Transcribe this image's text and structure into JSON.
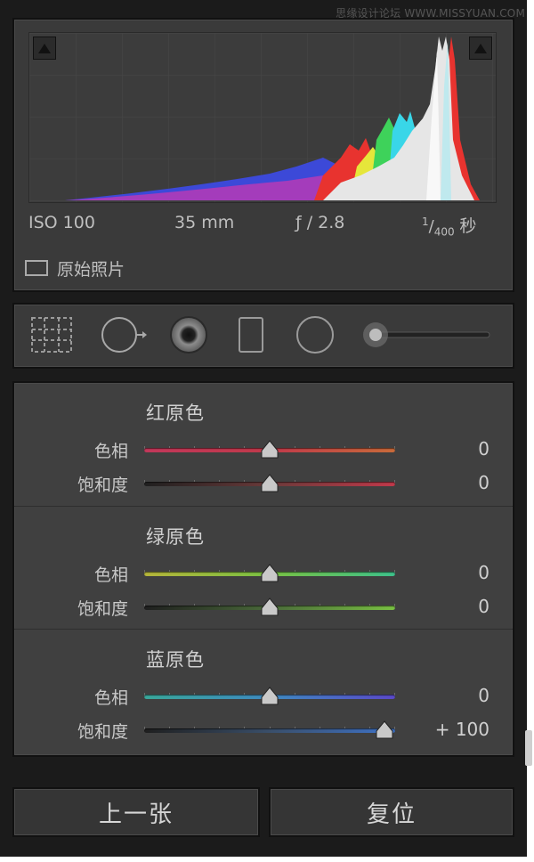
{
  "watermark": "思缘设计论坛 WWW.MISSYUAN.COM",
  "histogram": {
    "iso": "ISO 100",
    "focal_length": "35 mm",
    "aperture": "ƒ / 2.8",
    "shutter_num": "1",
    "shutter_den": "400",
    "shutter_unit": "秒",
    "original_photo_label": "原始照片"
  },
  "tools": [
    {
      "name": "crop-overlay-tool",
      "icon": "crop-grid-icon"
    },
    {
      "name": "spot-removal-tool",
      "icon": "spot-heal-icon"
    },
    {
      "name": "red-eye-tool",
      "icon": "red-eye-icon"
    },
    {
      "name": "graduated-filter-tool",
      "icon": "rect-filter-icon"
    },
    {
      "name": "radial-filter-tool",
      "icon": "circle-filter-icon"
    },
    {
      "name": "adjustment-brush-tool",
      "icon": "brush-slider-icon"
    }
  ],
  "calibration": {
    "red": {
      "title": "红原色",
      "hue_label": "色相",
      "hue_value": "0",
      "hue_pos": 0.5,
      "sat_label": "饱和度",
      "sat_value": "0",
      "sat_pos": 0.5
    },
    "green": {
      "title": "绿原色",
      "hue_label": "色相",
      "hue_value": "0",
      "hue_pos": 0.5,
      "sat_label": "饱和度",
      "sat_value": "0",
      "sat_pos": 0.5
    },
    "blue": {
      "title": "蓝原色",
      "hue_label": "色相",
      "hue_value": "0",
      "hue_pos": 0.5,
      "sat_label": "饱和度",
      "sat_value": "+ 100",
      "sat_pos": 1.0
    }
  },
  "buttons": {
    "previous": "上一张",
    "reset": "复位"
  },
  "colors": {
    "panel_bg": "#3a3a3a",
    "text": "#c8c8c8",
    "red_track": "#c0394a",
    "green_track": "#79c043",
    "blue_track": "#3e73c9"
  }
}
